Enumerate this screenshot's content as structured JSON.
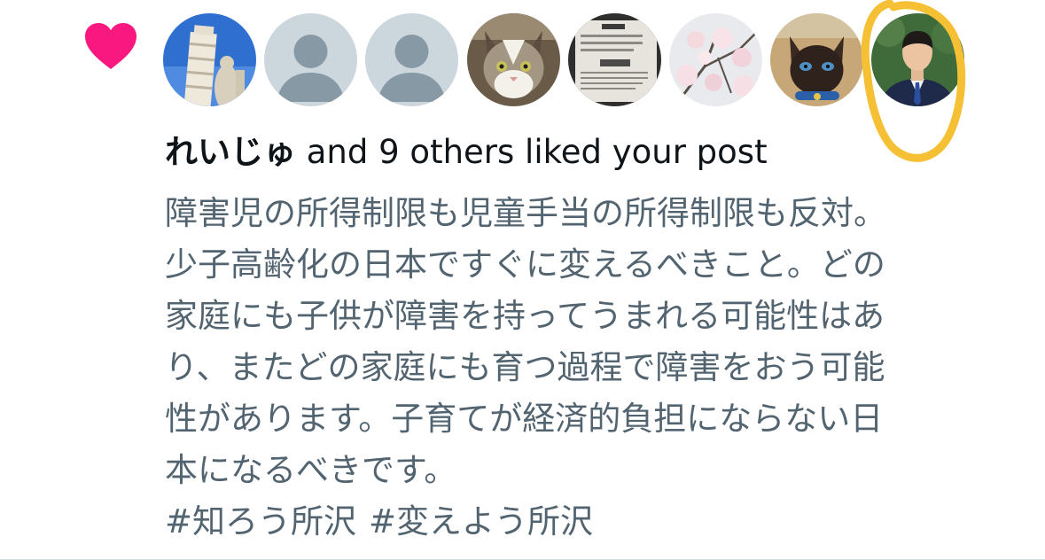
{
  "colors": {
    "heart": "#f91880",
    "annotation_highlight": "#f6c034",
    "primary_text": "#0f1419",
    "secondary_text": "#536471",
    "default_avatar_bg": "#ccd6dd",
    "default_avatar_fg": "#8899a6"
  },
  "notification": {
    "type_icon": "heart-icon",
    "liker_avatars": [
      {
        "kind": "photo",
        "subject": "leaning-tower-of-pisa"
      },
      {
        "kind": "default",
        "subject": "default-profile"
      },
      {
        "kind": "default",
        "subject": "default-profile"
      },
      {
        "kind": "photo",
        "subject": "cat"
      },
      {
        "kind": "photo",
        "subject": "parking-ticket"
      },
      {
        "kind": "photo",
        "subject": "cherry-blossoms"
      },
      {
        "kind": "photo",
        "subject": "siamese-cat"
      },
      {
        "kind": "photo",
        "subject": "man-in-suit"
      }
    ],
    "highlighted_avatar_index": 7,
    "summary": {
      "user_name": "れいじゅ",
      "rest": " and 9 others liked your post"
    },
    "post": {
      "lines": [
        "障害児の所得制限も児童手当の所得制限も反対。",
        "少子高齢化の日本ですぐに変えるべきこと。どの",
        "家庭にも子供が障害を持ってうまれる可能性はあ",
        "り、またどの家庭にも育つ過程で障害をおう可能",
        "性があります。子育てが経済的負担にならない日",
        "本になるべきです。"
      ],
      "hashtags": [
        "#知ろう所沢",
        "#変えよう所沢"
      ]
    }
  }
}
